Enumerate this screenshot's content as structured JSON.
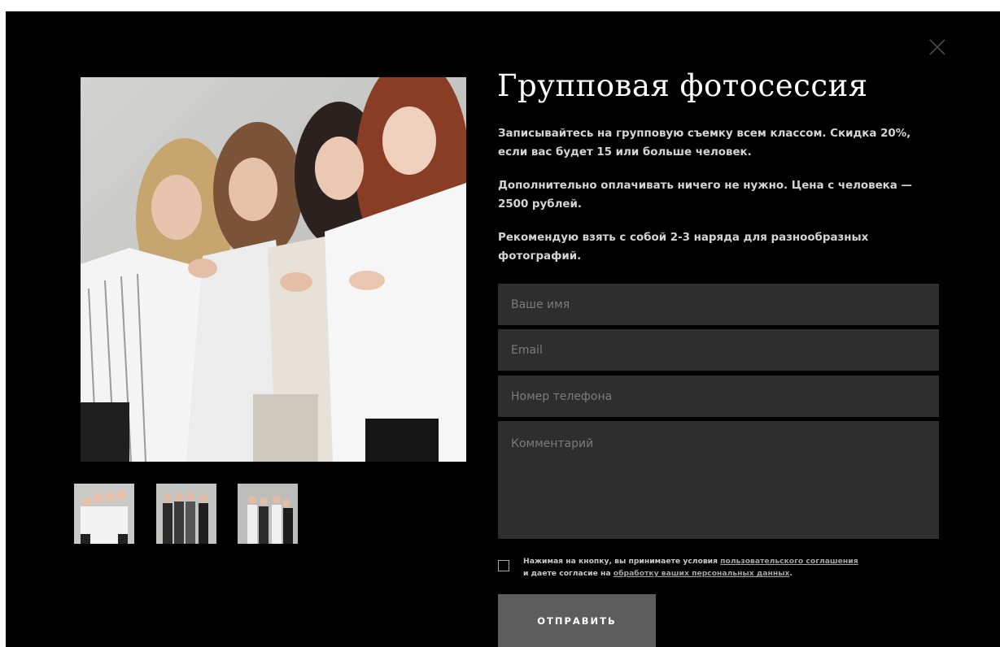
{
  "modal": {
    "title": "Групповая фотосессия",
    "paragraphs": [
      "Записывайтесь на групповую съемку всем классом. Скидка 20%, если вас будет 15 или больше человек.",
      "Дополнительно оплачивать ничего не нужно. Цена с человека — 2500 рублей.",
      "Рекомендую взять с собой 2-3 наряда для разнообразных фотографий."
    ],
    "close_icon": "close-icon"
  },
  "gallery": {
    "main_image": "group-photo-four-girls-white-shirts",
    "thumbnails": [
      "thumbnail-group-white-shirts",
      "thumbnail-group-dark-outfits",
      "thumbnail-group-mixed-outfits"
    ]
  },
  "form": {
    "name_placeholder": "Ваше имя",
    "email_placeholder": "Email",
    "phone_placeholder": "Номер телефона",
    "comment_placeholder": "Комментарий",
    "consent": {
      "text_1": "Нажимая на кнопку, вы принимаете условия ",
      "link_1": "пользовательского соглашения",
      "text_2": "и даете согласие на ",
      "link_2": "обработку ваших персональных данных",
      "text_3": "."
    },
    "submit_label": "ОТПРАВИТЬ"
  },
  "colors": {
    "page_background": "#ffffff",
    "modal_background": "#000000",
    "field_background": "#2e2e2e",
    "button_background": "#5d5d5d",
    "text_primary": "#ffffff",
    "text_body": "#d4d4d4"
  }
}
